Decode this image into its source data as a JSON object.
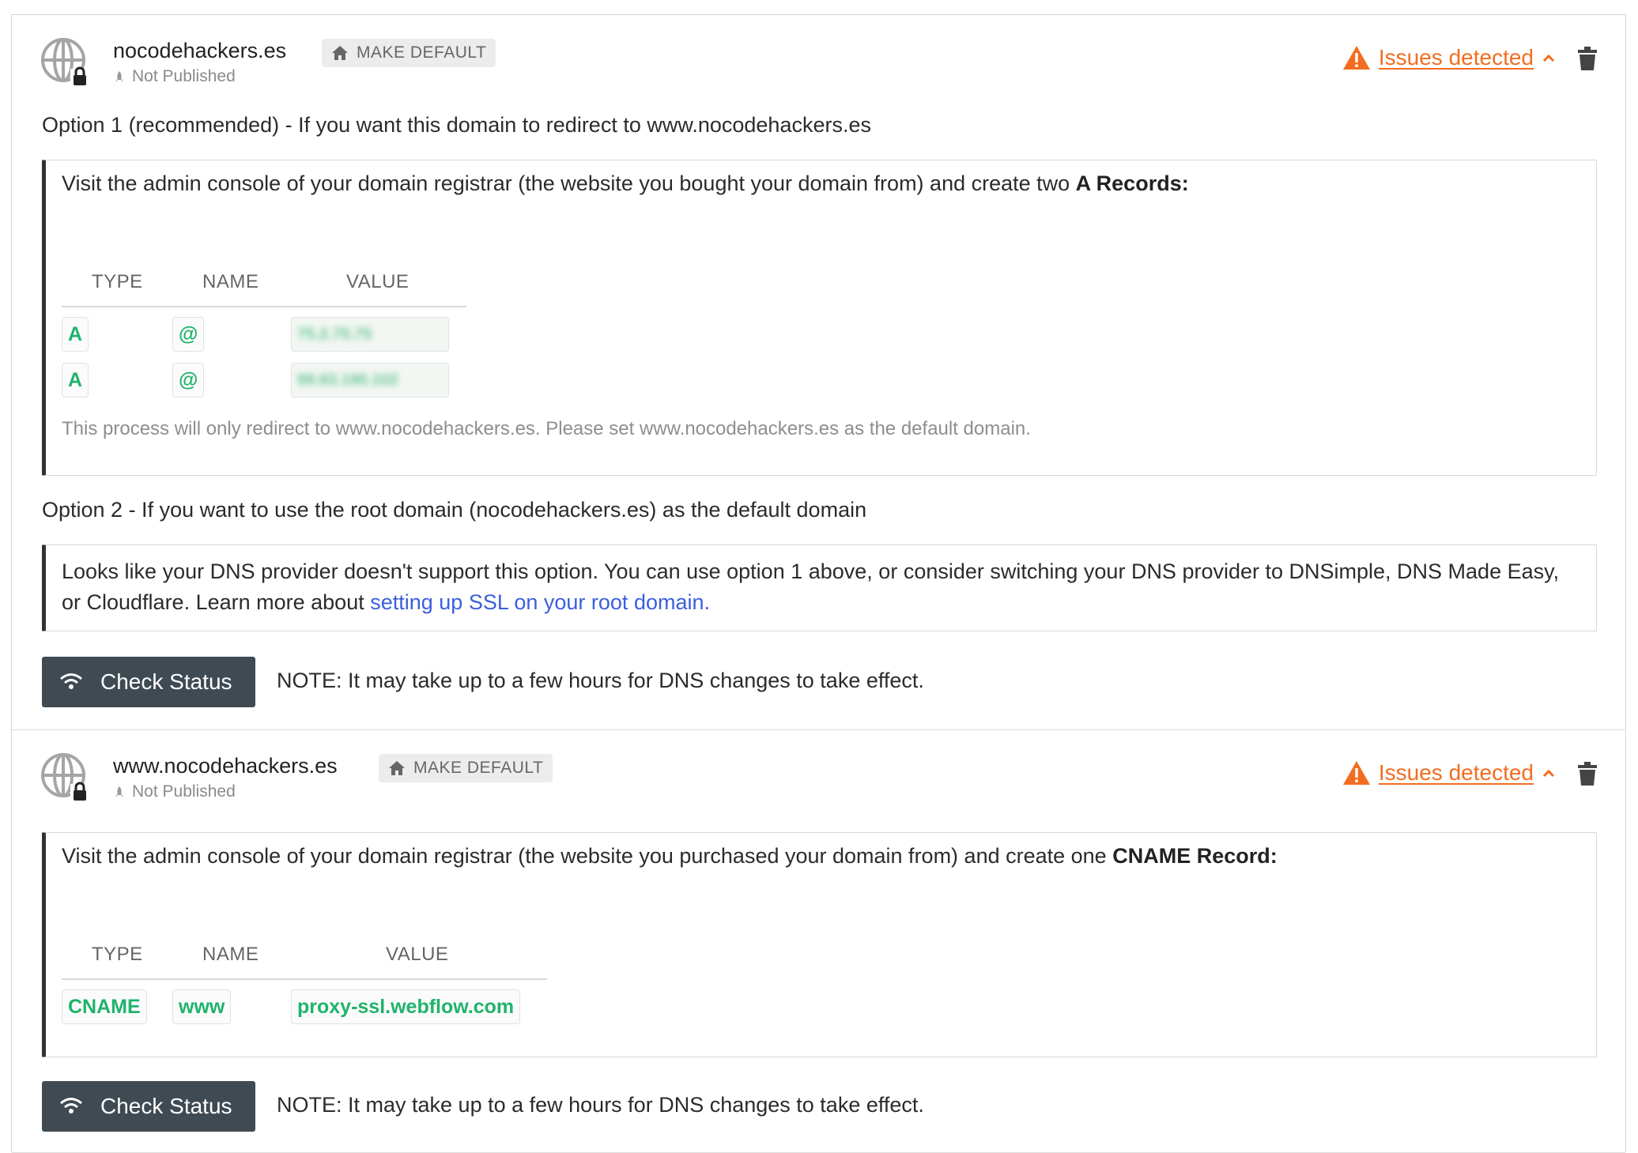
{
  "domains": [
    {
      "name": "nocodehackers.es",
      "make_default": "MAKE DEFAULT",
      "status": "Not Published",
      "issues": "Issues detected",
      "option1": "Option 1 (recommended) - If you want this domain to redirect to www.nocodehackers.es",
      "instruction_prefix": "Visit the admin console of your domain registrar (the website you bought your domain from) and create two ",
      "instruction_bold": "A Records:",
      "table_headers": [
        "TYPE",
        "NAME",
        "VALUE"
      ],
      "records": [
        {
          "type": "A",
          "name": "@",
          "value": "75.2.70.75"
        },
        {
          "type": "A",
          "name": "@",
          "value": "99.83.190.102"
        }
      ],
      "redirect_note": "This process will only redirect to www.nocodehackers.es. Please set www.nocodehackers.es as the default domain.",
      "option2": "Option 2 - If you want to use the root domain (nocodehackers.es) as the default domain",
      "option2_text": "Looks like your DNS provider doesn't support this option. You can use option 1 above, or consider switching your DNS provider to DNSimple, DNS Made Easy, or Cloudflare. Learn more about ",
      "option2_link": "setting up SSL on your root domain.",
      "check_status": "Check Status",
      "note": "NOTE: It may take up to a few hours for DNS changes to take effect."
    },
    {
      "name": "www.nocodehackers.es",
      "make_default": "MAKE DEFAULT",
      "status": "Not Published",
      "issues": "Issues detected",
      "instruction_prefix": "Visit the admin console of your domain registrar (the website you purchased your domain from) and create one ",
      "instruction_bold": "CNAME Record:",
      "table_headers": [
        "TYPE",
        "NAME",
        "VALUE"
      ],
      "records": [
        {
          "type": "CNAME",
          "name": "www",
          "value": "proxy-ssl.webflow.com"
        }
      ],
      "check_status": "Check Status",
      "note": "NOTE: It may take up to a few hours for DNS changes to take effect."
    }
  ],
  "colors": {
    "accent_warning": "#f26d21",
    "record_green": "#1fb36b",
    "link_blue": "#3b5fdc",
    "button_dark": "#3f4a52"
  },
  "icons": [
    "globe-lock-icon",
    "home-icon",
    "rocket-icon",
    "warning-icon",
    "chevron-up-icon",
    "trash-icon",
    "wifi-icon"
  ]
}
